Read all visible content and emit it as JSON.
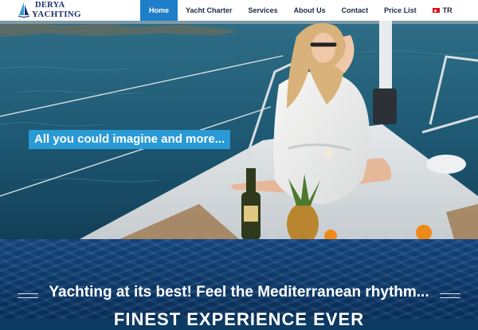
{
  "brand": {
    "line1": "DERYA",
    "line2": "YACHTING"
  },
  "nav": {
    "items": [
      "Home",
      "Yacht Charter",
      "Services",
      "About Us",
      "Contact",
      "Price List"
    ],
    "active_index": 0,
    "language": "TR"
  },
  "hero": {
    "tagline": "All you could imagine and more...",
    "image": "woman in white robe on sailing yacht deck with sea view"
  },
  "section": {
    "headline": "Yachting at its best! Feel the Mediterranean rhythm...",
    "subheadline": "FINEST EXPERIENCE EVER"
  },
  "colors": {
    "nav_active": "#1e7ec8",
    "tagline_bg": "#2a9ad6",
    "brand": "#1b2f6e",
    "sea_band": "#0e3d70"
  }
}
